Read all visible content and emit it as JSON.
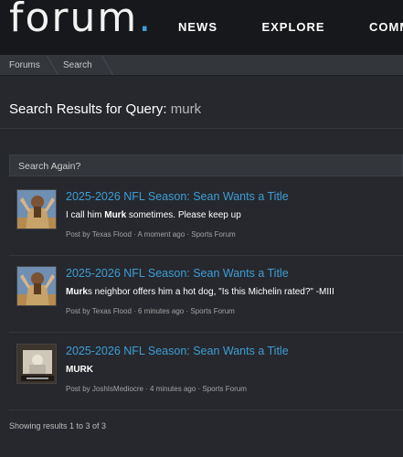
{
  "header": {
    "logo_text": "forum",
    "logo_dot": ".",
    "nav": [
      "NEWS",
      "EXPLORE",
      "COMM"
    ]
  },
  "breadcrumb": [
    "Forums",
    "Search"
  ],
  "search": {
    "title_prefix": "Search Results for Query:",
    "query": "murk",
    "search_again_label": "Search Again?"
  },
  "results": [
    {
      "title": "2025-2026 NFL Season: Sean Wants a Title",
      "snippet_pre": "I call him ",
      "snippet_bold": "Murk",
      "snippet_post": " sometimes. Please keep up",
      "meta": "Post by Texas Flood · A moment ago · Sports Forum"
    },
    {
      "title": "2025-2026 NFL Season: Sean Wants a Title",
      "snippet_pre": "",
      "snippet_bold": "Murk",
      "snippet_post": "s neighbor offers him a hot dog, \"Is this Michelin rated?\" -MIII",
      "meta": "Post by Texas Flood · 6 minutes ago · Sports Forum"
    },
    {
      "title": "2025-2026 NFL Season: Sean Wants a Title",
      "snippet_pre": "",
      "snippet_bold": "MURK",
      "snippet_post": "",
      "meta": "Post by JoshIsMediocre · 4 minutes ago · Sports Forum"
    }
  ],
  "footer": {
    "count_text": "Showing results 1 to 3 of 3"
  },
  "colors": {
    "accent": "#3d9ed6",
    "background": "#26282d",
    "header": "#17181b"
  }
}
